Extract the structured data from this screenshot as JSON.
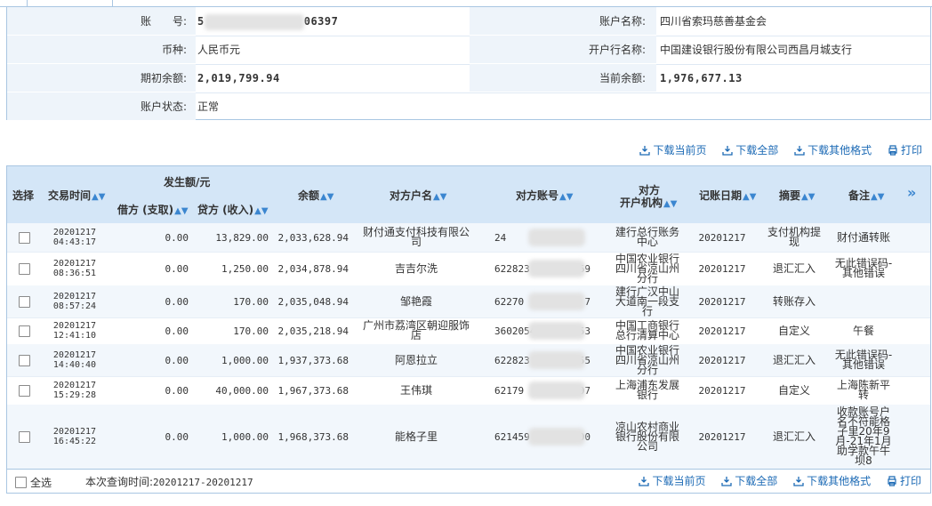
{
  "account": {
    "account_no_label": "账　　号:",
    "account_no_prefix": "5",
    "account_no_suffix": "06397",
    "account_name_label": "账户名称:",
    "account_name": "四川省索玛慈善基金会",
    "currency_label": "币种:",
    "currency": "人民币元",
    "bank_label": "开户行名称:",
    "bank": "中国建设银行股份有限公司西昌月城支行",
    "opening_balance_label": "期初余额:",
    "opening_balance": "2,019,799.94",
    "current_balance_label": "当前余额:",
    "current_balance": "1,976,677.13",
    "status_label": "账户状态:",
    "status": "正常"
  },
  "actions": {
    "download_page": "下载当前页",
    "download_all": "下载全部",
    "download_other": "下载其他格式",
    "print": "打印"
  },
  "table": {
    "headers": {
      "select": "选择",
      "time": "交易时间",
      "amount_group": "发生额/元",
      "debit": "借方 (支取)",
      "credit": "贷方 (收入)",
      "balance": "余额",
      "counterparty_name": "对方户名",
      "counterparty_account": "对方账号",
      "counterparty_bank_1": "对方",
      "counterparty_bank_2": "开户机构",
      "post_date": "记账日期",
      "summary": "摘要",
      "remark": "备注",
      "more": "»"
    },
    "rows": [
      {
        "date": "20201217",
        "time": "04:43:17",
        "debit": "0.00",
        "credit": "13,829.00",
        "balance": "2,033,628.94",
        "name": "财付通支付科技有限公司",
        "acc_a": "24",
        "acc_b": "",
        "bank": "建行总行账务中心",
        "post": "20201217",
        "summary": "支付机构提现",
        "remark": "财付通转账"
      },
      {
        "date": "20201217",
        "time": "08:36:51",
        "debit": "0.00",
        "credit": "1,250.00",
        "balance": "2,034,878.94",
        "name": "吉吉尔洗",
        "acc_a": "622823",
        "acc_b": "69",
        "bank": "中国农业银行四川省凉山州分行",
        "post": "20201217",
        "summary": "退汇汇入",
        "remark": "无此错误码-其他错误"
      },
      {
        "date": "20201217",
        "time": "08:57:24",
        "debit": "0.00",
        "credit": "170.00",
        "balance": "2,035,048.94",
        "name": "邹艳霞",
        "acc_a": "62270",
        "acc_b": "7",
        "bank": "建行广汉中山大道南一段支行",
        "post": "20201217",
        "summary": "转账存入",
        "remark": ""
      },
      {
        "date": "20201217",
        "time": "12:41:10",
        "debit": "0.00",
        "credit": "170.00",
        "balance": "2,035,218.94",
        "name": "广州市荔湾区朝迎服饰店",
        "acc_a": "36020545",
        "acc_b": "53",
        "bank": "中国工商银行总行清算中心",
        "post": "20201217",
        "summary": "自定义",
        "remark": "午餐"
      },
      {
        "date": "20201217",
        "time": "14:40:40",
        "debit": "0.00",
        "credit": "1,000.00",
        "balance": "1,937,373.68",
        "name": "阿恩拉立",
        "acc_a": "622823",
        "acc_b": "55",
        "bank": "中国农业银行四川省凉山州分行",
        "post": "20201217",
        "summary": "退汇汇入",
        "remark": "无此错误码-其他错误"
      },
      {
        "date": "20201217",
        "time": "15:29:28",
        "debit": "0.00",
        "credit": "40,000.00",
        "balance": "1,967,373.68",
        "name": "王伟琪",
        "acc_a": "62179",
        "acc_b": "007",
        "bank": "上海浦东发展银行",
        "post": "20201217",
        "summary": "自定义",
        "remark": "上海陈新平转"
      },
      {
        "date": "20201217",
        "time": "16:45:22",
        "debit": "0.00",
        "credit": "1,000.00",
        "balance": "1,968,373.68",
        "name": "能格子里",
        "acc_a": "621459",
        "acc_b": "4700",
        "bank": "凉山农村商业银行股份有限公司",
        "post": "20201217",
        "summary": "退汇汇入",
        "remark": "收款账号户名不符能格子里20年9月-21年1月助学款午牛坝8"
      }
    ]
  },
  "footer": {
    "select_all": "全选",
    "query_time_label": "本次查询时间:",
    "query_time": "20201217-20201217"
  },
  "colors": {
    "accent": "#1c6ab5",
    "header_bg": "#d4e6f7",
    "border": "#a9c6e2"
  }
}
